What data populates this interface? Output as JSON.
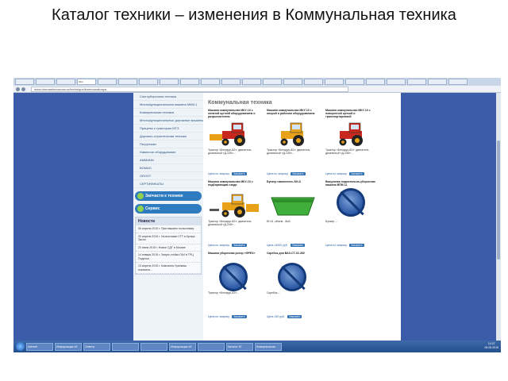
{
  "slide": {
    "title": "Каталог техники – изменения в Коммунальная техника"
  },
  "browser": {
    "tabs": [
      "",
      "",
      "",
      "Mos",
      "",
      "",
      "",
      "",
      "",
      "",
      "",
      "",
      "",
      "",
      "",
      "",
      "",
      "",
      "",
      "",
      "",
      ""
    ],
    "url": "www.dormashmoscow.ru/technique/kommunalnaya"
  },
  "sidebar": {
    "items": [
      "Снегоуборочная техника",
      "Многофункциональная машина МКМ-1",
      "Коммунальная техника",
      "Многофункциональные дорожные машины с ЩДК Трайкс 2000",
      "Прицепы к тракторам МТЗ",
      "Дорожно-строительная техника",
      "Погрузчики",
      "Навесное оборудование",
      "AMMANN",
      "BOMAG",
      "GROST",
      "СЕРТИФИКАТЫ"
    ],
    "parts_button": "Запчасти к технике",
    "service_button": "Сервис",
    "news": {
      "title": "Новости",
      "items": [
        "06 апреля 2015 г. Приглашаем на выставку",
        "20 апреля 2015 г. На выставке СТТ в Крокус Экспо",
        "20 июня 2015 г. Новое СДТ в Москве",
        "14 января 2015 г. Запуск стойки ГАИ в ТРЦ Поделки",
        "13 апреля 2015 г. Компания Уралмаш показала..."
      ]
    }
  },
  "content": {
    "title": "Коммунальная техника",
    "cards": [
      {
        "name": "Машина коммунальная МКУ-10 с лопатой щеткой оборудованием и разрыхлителем",
        "desc": "Трактор «Беларус-82»: двигатель дизельный «Д-245»...",
        "price": "Цена по запросу",
        "buy": "Заказать"
      },
      {
        "name": "Машина коммунальная МКУ-10 с опорой и рабочим оборудованием",
        "desc": "Трактор «Беларус-82»: двигатель дизельный «Д-245»...",
        "price": "Цена по запросу",
        "buy": "Заказать"
      },
      {
        "name": "Машина коммунальная МКУ-10 с поворотной щеткой и транспортировкой",
        "desc": "Трактор «Беларус-82»: двигатель дизельный «Д-245»...",
        "price": "Цена по запросу",
        "buy": "Заказать"
      },
      {
        "name": "Машина коммунальная МКУ-10 с подбирающим сзади",
        "desc": "Трактор «Беларус-82»: двигатель дизельный «Д-245»...",
        "price": "Цена по запросу",
        "buy": "Заказать"
      },
      {
        "name": "Бункер накопитель БН-8",
        "desc": "БН-8, объем - 8м3",
        "price": "Цена 14000 руб.",
        "buy": "Заказать"
      },
      {
        "name": "Вакуумная подметально-уборочная машина ВПМ-11",
        "desc": "Бункер ...",
        "price": "Цена по запросу",
        "buy": "Заказать"
      },
      {
        "name": "Машина уборочная ротор «ФРЕЗ»",
        "desc": "Трактор «Беларус-82»...",
        "price": "Цена по запросу",
        "buy": "Заказать"
      },
      {
        "name": "Скребок для ВАЗ-СТ-02-280",
        "desc": "Скребок ...",
        "price": "Цена 150 руб.",
        "buy": "Заказать"
      }
    ]
  },
  "taskbar": {
    "tasks": [
      "Internet",
      "Информация об",
      "Ответы",
      "",
      "",
      "Информация об",
      "",
      "Каталог КГ",
      "Коммунальная"
    ],
    "time": "14:37",
    "date": "06.05.2015"
  },
  "colors": {
    "desktop": "#3b5ca8",
    "accent": "#2f7bbf",
    "tractor_orange": "#e8a21a",
    "tractor_red": "#c9281f",
    "bunker_green": "#3fae3a"
  }
}
